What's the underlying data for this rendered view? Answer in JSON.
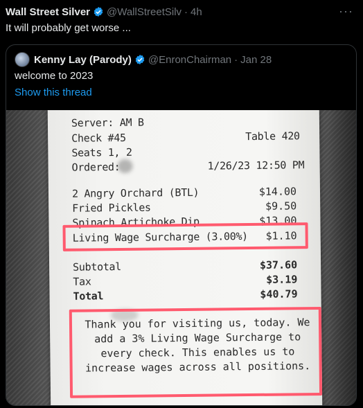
{
  "tweet": {
    "author_name": "Wall Street Silver",
    "handle": "@WallStreetSilv",
    "separator": "·",
    "time": "4h",
    "more_label": "···",
    "text": "It will probably get worse ..."
  },
  "quoted": {
    "author_name": "Kenny Lay (Parody)",
    "handle": "@EnronChairman",
    "separator": "·",
    "date": "Jan 28",
    "text": "welcome to 2023",
    "show_thread": "Show this thread"
  },
  "receipt": {
    "server": "Server: AM B",
    "check": "Check #45",
    "table": "Table 420",
    "seats": "Seats 1, 2",
    "ordered_label": "Ordered:",
    "ordered_datetime": "1/26/23 12:50 PM",
    "items": [
      {
        "name": "2 Angry Orchard (BTL)",
        "price": "$14.00"
      },
      {
        "name": "Fried Pickles",
        "price": "$9.50"
      },
      {
        "name": "Spinach Artichoke Dip",
        "price": "$13.00"
      },
      {
        "name": "Living Wage Surcharge (3.00%)",
        "price": "$1.10"
      }
    ],
    "subtotal_label": "Subtotal",
    "subtotal": "$37.60",
    "tax_label": "Tax",
    "tax": "$3.19",
    "total_label": "Total",
    "total": "$40.79",
    "footer": "Thank you for visiting us, today. We add a 3% Living Wage Surcharge to every check. This enables us to increase wages across all positions."
  },
  "colors": {
    "background": "#000000",
    "text": "#e7e9ea",
    "muted": "#71767b",
    "link": "#1d9bf0",
    "verified": "#1d9bf0",
    "highlight": "#ff5a6e"
  }
}
